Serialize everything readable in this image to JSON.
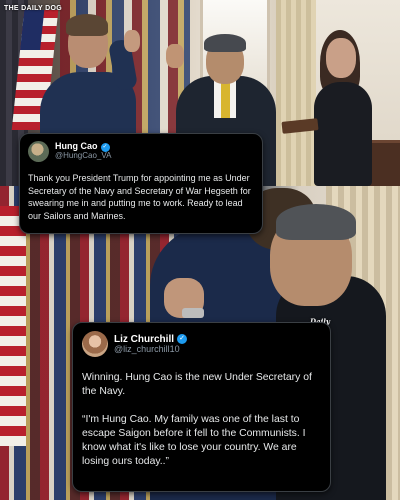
{
  "watermark": "THE DAILY DOG",
  "logo_text": "Daily Dog",
  "tweets": [
    {
      "display_name": "Hung Cao",
      "handle": "@HungCao_VA",
      "verified": true,
      "text": "Thank you President Trump for appointing me as Under Secretary of the Navy and Secretary of War Hegseth for swearing me in and putting me to work. Ready to lead our Sailors and Marines."
    },
    {
      "display_name": "Liz Churchill",
      "handle": "@liz_churchill10",
      "verified": true,
      "paragraphs": [
        "Winning. Hung Cao is the new Under Secretary of the Navy.",
        "“I'm Hung Cao. My family was one of the last to escape Saigon before it fell to the Communists. I know what it's like to lose your country. We are losing ours today..”"
      ]
    }
  ],
  "icons": {
    "verified": "verified-badge-icon"
  },
  "colors": {
    "card_bg": "#000000",
    "text": "#e7e9ea",
    "handle": "#8b98a5",
    "verified": "#1d9bf0"
  }
}
